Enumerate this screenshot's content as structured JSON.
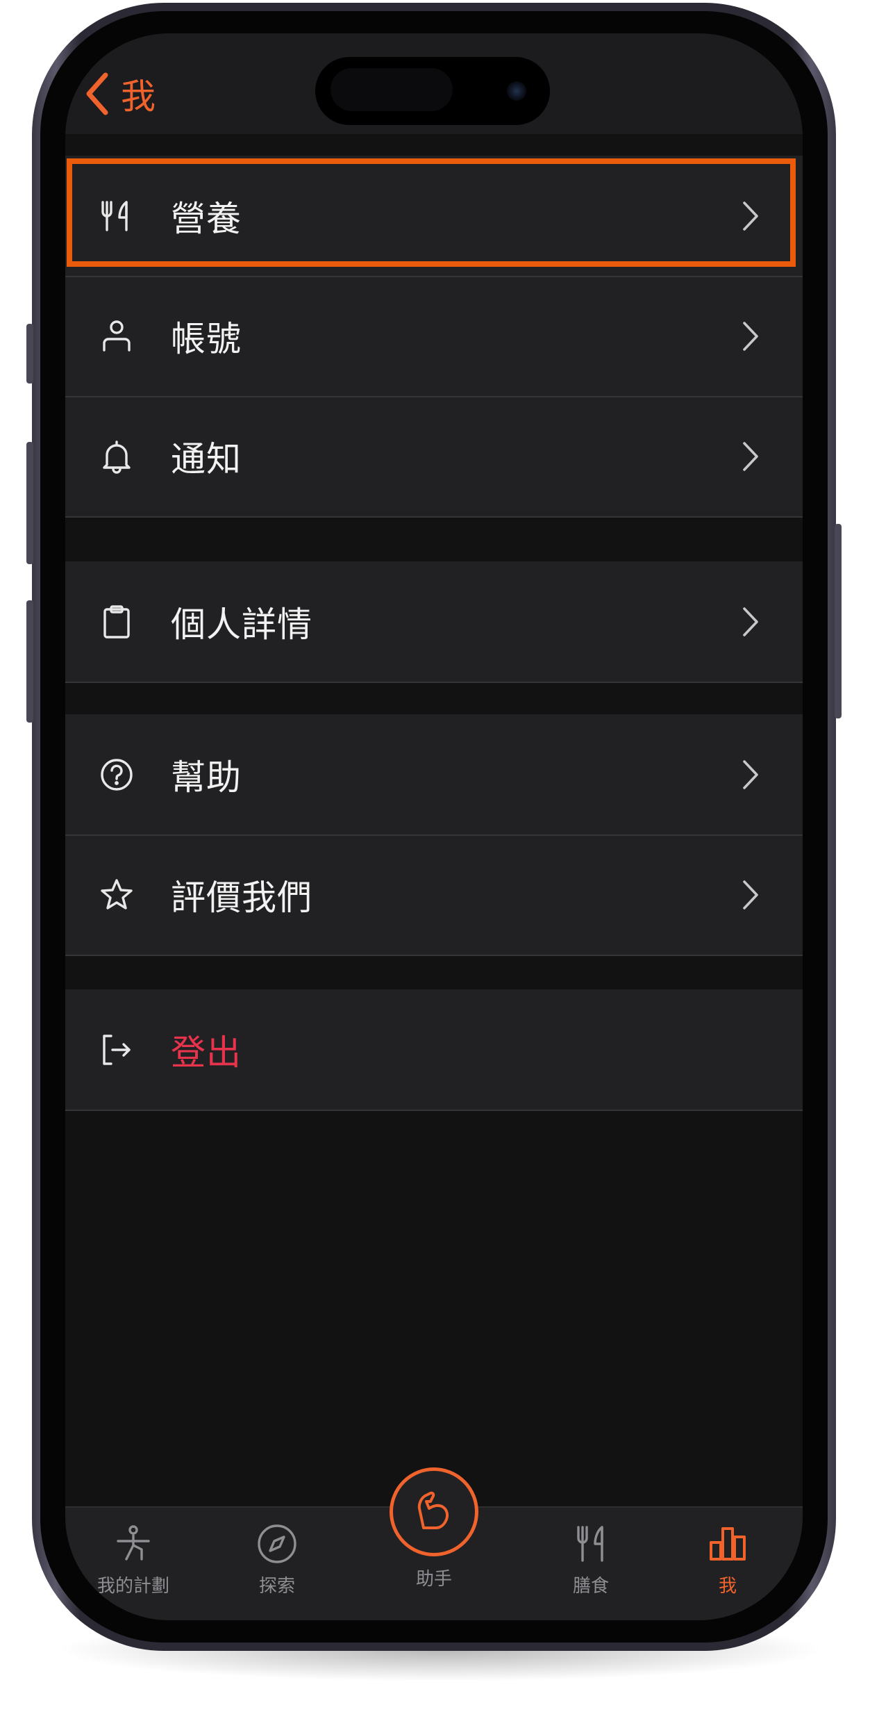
{
  "colors": {
    "accent": "#f0632d",
    "danger": "#e8334d",
    "highlight": "#ea5b0c",
    "background": "#121212",
    "row": "#212123"
  },
  "header": {
    "back_label": "我"
  },
  "menu": {
    "nutrition": {
      "label": "營養",
      "icon": "fork-knife-icon"
    },
    "account": {
      "label": "帳號",
      "icon": "person-icon"
    },
    "notifications": {
      "label": "通知",
      "icon": "bell-icon"
    },
    "personal_details": {
      "label": "個人詳情",
      "icon": "clipboard-icon"
    },
    "help": {
      "label": "幫助",
      "icon": "question-circle-icon"
    },
    "rate_us": {
      "label": "評價我們",
      "icon": "star-icon"
    },
    "logout": {
      "label": "登出",
      "icon": "logout-icon"
    }
  },
  "tabbar": {
    "plan": {
      "label": "我的計劃",
      "icon": "stretch-figure-icon"
    },
    "explore": {
      "label": "探索",
      "icon": "compass-icon"
    },
    "assistant": {
      "label": "助手",
      "icon": "flexed-arm-icon"
    },
    "meals": {
      "label": "膳食",
      "icon": "fork-knife-icon"
    },
    "me": {
      "label": "我",
      "icon": "bar-chart-icon",
      "active": "true"
    }
  }
}
